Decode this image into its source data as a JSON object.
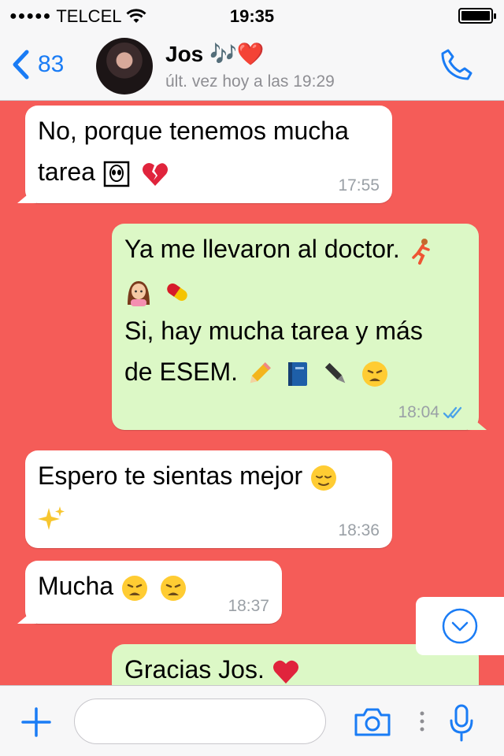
{
  "status": {
    "carrier": "TELCEL",
    "time": "19:35",
    "battery_level": 0.9
  },
  "header": {
    "back_count": "83",
    "contact_name": "Jos 🎶❤️",
    "last_seen": "últ. vez hoy a las 19:29"
  },
  "messages": [
    {
      "direction": "in",
      "line1": "No, porque tenemos mucha",
      "line2": "tarea",
      "emojis": [
        "alien-square-icon",
        "broken-heart-icon"
      ],
      "time": "17:55"
    },
    {
      "direction": "out",
      "line1": "Ya me llevaron al doctor.",
      "line3": "Si, hay mucha tarea y más",
      "line4": "de ESEM.",
      "emojis": [
        "runner-icon",
        "woman-icon",
        "pill-icon",
        "pencil-icon",
        "book-icon",
        "pen-icon",
        "weary-face-icon"
      ],
      "time": "18:04",
      "status": "read"
    },
    {
      "direction": "in",
      "line1": "Espero te sientas mejor",
      "emojis": [
        "relieved-face-icon",
        "sparkles-icon"
      ],
      "time": "18:36"
    },
    {
      "direction": "in",
      "line1": "Mucha",
      "emojis": [
        "weary-face-icon",
        "weary-face-icon"
      ],
      "time": "18:37"
    },
    {
      "direction": "out",
      "line1": "Gracias Jos.",
      "emojis": [
        "heart-icon"
      ]
    }
  ],
  "input": {
    "placeholder": ""
  },
  "colors": {
    "accent": "#1a7cf5",
    "chat_background": "#f55c58",
    "outgoing": "#dcf8c6",
    "incoming": "#ffffff"
  }
}
